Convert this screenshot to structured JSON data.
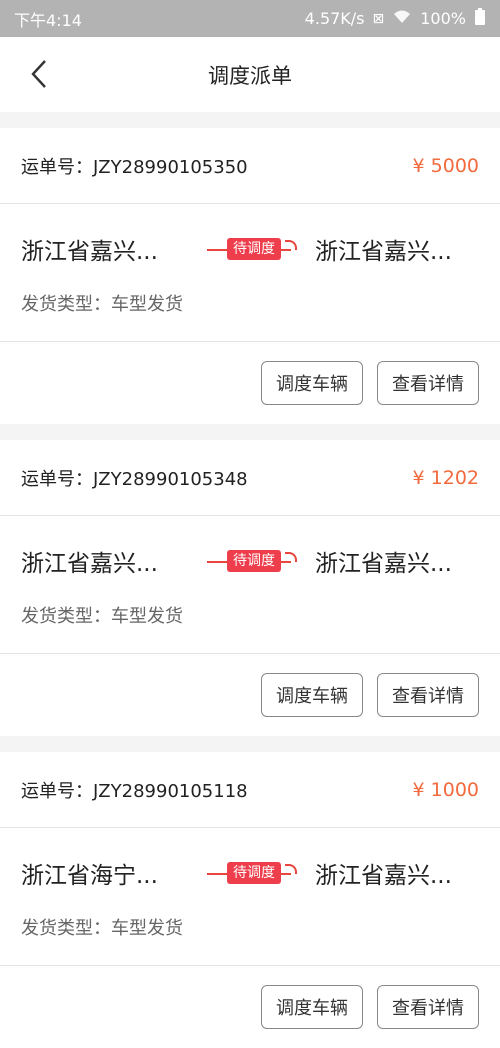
{
  "status_bar": {
    "time": "下午4:14",
    "speed": "4.57K/s",
    "battery": "100%"
  },
  "nav": {
    "title": "调度派单"
  },
  "labels": {
    "order_prefix": "运单号：",
    "ship_type_prefix": "发货类型：",
    "dispatch_button": "调度车辆",
    "detail_button": "查看详情",
    "status_badge": "待调度"
  },
  "orders": [
    {
      "order_no": "JZY28990105350",
      "price": "¥ 5000",
      "from": "浙江省嘉兴...",
      "to": "浙江省嘉兴...",
      "ship_type": "车型发货"
    },
    {
      "order_no": "JZY28990105348",
      "price": "¥ 1202",
      "from": "浙江省嘉兴...",
      "to": "浙江省嘉兴...",
      "ship_type": "车型发货"
    },
    {
      "order_no": "JZY28990105118",
      "price": "¥ 1000",
      "from": "浙江省海宁...",
      "to": "浙江省嘉兴...",
      "ship_type": "车型发货"
    }
  ],
  "colors": {
    "price": "#f26a3d",
    "badge": "#ee3d4b",
    "status_bar": "#b3b3b3"
  }
}
